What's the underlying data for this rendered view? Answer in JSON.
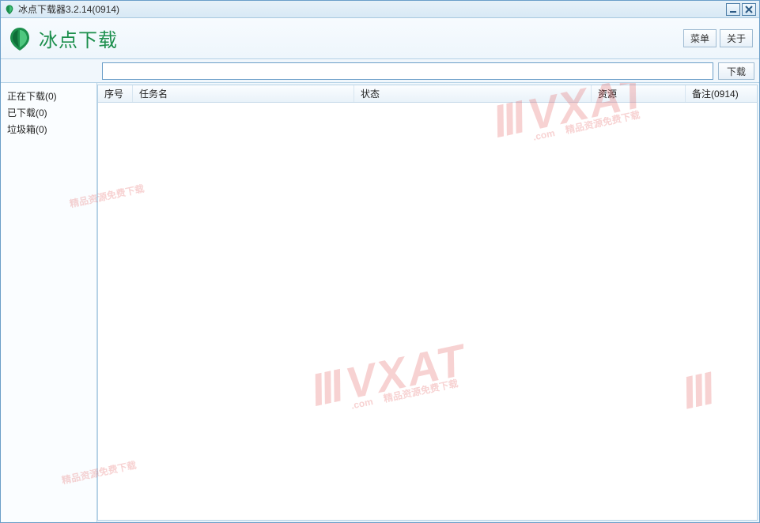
{
  "window": {
    "title": "冰点下载器3.2.14(0914)"
  },
  "brand": {
    "name": "冰点下载"
  },
  "header_buttons": {
    "menu": "菜单",
    "about": "关于"
  },
  "toolbar": {
    "url_value": "",
    "url_placeholder": "",
    "download_label": "下载"
  },
  "sidebar": {
    "items": [
      {
        "label": "正在下载(0)"
      },
      {
        "label": "已下载(0)"
      },
      {
        "label": "垃圾箱(0)"
      }
    ]
  },
  "columns": {
    "seq": "序号",
    "task": "任务名",
    "state": "状态",
    "resource": "资源",
    "note": "备注(0914)"
  },
  "watermark": {
    "main": "VXAT",
    "sub_left": ".com",
    "sub_right": "精品资源免费下载"
  }
}
